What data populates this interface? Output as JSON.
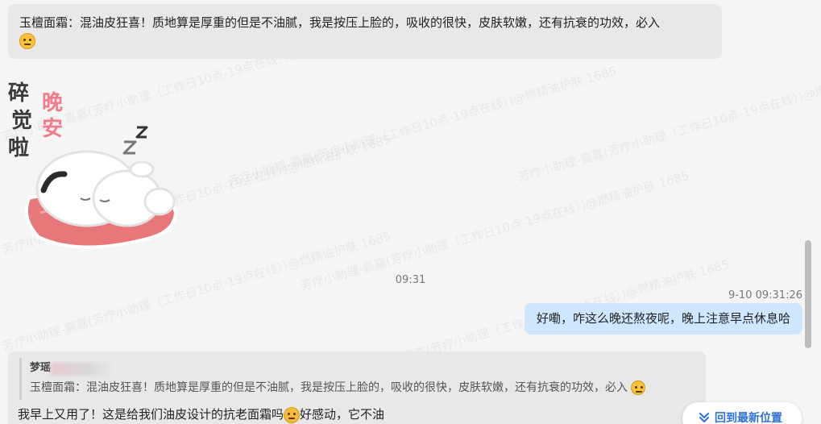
{
  "watermark": {
    "text": "芳疗小助理-嘉嘉(芳疗小助理（工作日10点-19点在线）)@燃精油护肤 1685"
  },
  "messages": {
    "first": {
      "text": "玉檀面霜：混油皮狂喜！质地算是厚重的但是不油腻，我是按压上脸的，吸收的很快，皮肤软嫩，还有抗衰的功效，必入",
      "emoji": "thinking-emoji"
    },
    "sticker": {
      "left_text": "碎觉啦",
      "right_text": "晚安"
    },
    "time_divider": "09:31",
    "outgoing": {
      "timestamp": "9-10 09:31:26",
      "text": "好嘞，咋这么晚还熬夜呢，晚上注意早点休息哈"
    },
    "reply": {
      "quote_author": "梦瑶",
      "quote_text": "玉檀面霜：混油皮狂喜！质地算是厚重的但是不油腻，我是按压上脸的，吸收的很快，皮肤软嫩，还有抗衰的功效，必入",
      "text_before": "我早上又用了！这是给我们油皮设计的抗老面霜吗",
      "text_after": "好感动，它不油"
    }
  },
  "back_to_latest": {
    "label": "回到最新位置"
  },
  "colors": {
    "incoming_bubble": "#e8e8e8",
    "outgoing_bubble": "#cfe6ff",
    "link": "#2f72d6",
    "background": "#f5f5f5"
  }
}
